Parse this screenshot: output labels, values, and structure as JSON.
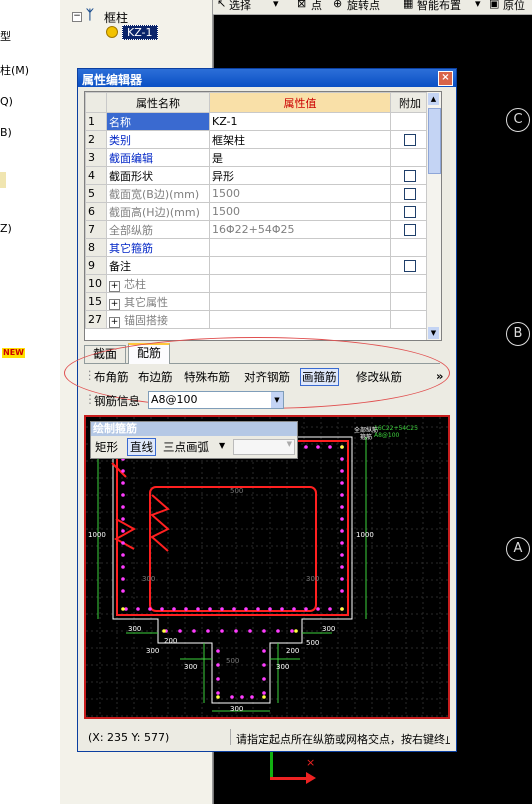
{
  "left_menu": {
    "items": [
      "型",
      "柱(M)",
      "Q)",
      "B)",
      "Z)"
    ],
    "new_badge": "NEW"
  },
  "tree": {
    "expand": "−",
    "root_label": "框柱",
    "leaf_label": "KZ-1"
  },
  "toolbar": {
    "select": "选择",
    "point": "点",
    "rotate_point": "旋转点",
    "smart_layout": "智能布置",
    "origin": "原位"
  },
  "axes": [
    "C",
    "B",
    "A"
  ],
  "dialog": {
    "title": "属性编辑器",
    "close": "×",
    "headers": {
      "name": "属性名称",
      "value": "属性值",
      "extra": "附加"
    },
    "rows": [
      {
        "num": "1",
        "name": "名称",
        "value": "KZ-1",
        "checkbox": false,
        "style": "selected"
      },
      {
        "num": "2",
        "name": "类别",
        "value": "框架柱",
        "checkbox": true,
        "style": "blue"
      },
      {
        "num": "3",
        "name": "截面编辑",
        "value": "是",
        "checkbox": false,
        "style": "blue"
      },
      {
        "num": "4",
        "name": "截面形状",
        "value": "异形",
        "checkbox": true,
        "style": "normal"
      },
      {
        "num": "5",
        "name": "截面宽(B边)(mm)",
        "value": "1500",
        "checkbox": true,
        "style": "gray"
      },
      {
        "num": "6",
        "name": "截面高(H边)(mm)",
        "value": "1500",
        "checkbox": true,
        "style": "gray"
      },
      {
        "num": "7",
        "name": "全部纵筋",
        "value": "16Φ22+54Φ25",
        "checkbox": true,
        "style": "gray"
      },
      {
        "num": "8",
        "name": "其它箍筋",
        "value": "",
        "checkbox": false,
        "style": "blue"
      },
      {
        "num": "9",
        "name": "备注",
        "value": "",
        "checkbox": true,
        "style": "normal"
      },
      {
        "num": "10",
        "name": "芯柱",
        "value": "",
        "checkbox": false,
        "style": "group"
      },
      {
        "num": "15",
        "name": "其它属性",
        "value": "",
        "checkbox": false,
        "style": "group"
      },
      {
        "num": "27",
        "name": "锚固搭接",
        "value": "",
        "checkbox": false,
        "style": "group"
      }
    ],
    "tabs": [
      "截面",
      "配筋"
    ],
    "active_tab": "配筋",
    "rebar_buttons": [
      "布角筋",
      "布边筋",
      "特殊布筋",
      "对齐钢筋",
      "画箍筋",
      "修改纵筋"
    ],
    "active_rebar_button": "画箍筋",
    "more": "»",
    "rebar_info_label": "钢筋信息",
    "rebar_info_value": "A8@100",
    "stirrup_panel": {
      "title": "绘制箍筋",
      "buttons": [
        "矩形",
        "直线",
        "三点画弧"
      ],
      "active": "直线"
    },
    "drawing_labels": {
      "all_rebar_label": "全部纵筋",
      "all_rebar_value": "16C22+54C25",
      "stirrup_label": "箍筋",
      "stirrup_value": "A8@100",
      "dims": [
        "300",
        "300",
        "300",
        "300",
        "200",
        "500",
        "300",
        "1000",
        "1000",
        "500",
        "300",
        "200",
        "300",
        "500",
        "300"
      ]
    },
    "status": {
      "coords": "(X: 235 Y: 577)",
      "message": "请指定起点所在纵筋或网格交点，按右键终止"
    }
  }
}
